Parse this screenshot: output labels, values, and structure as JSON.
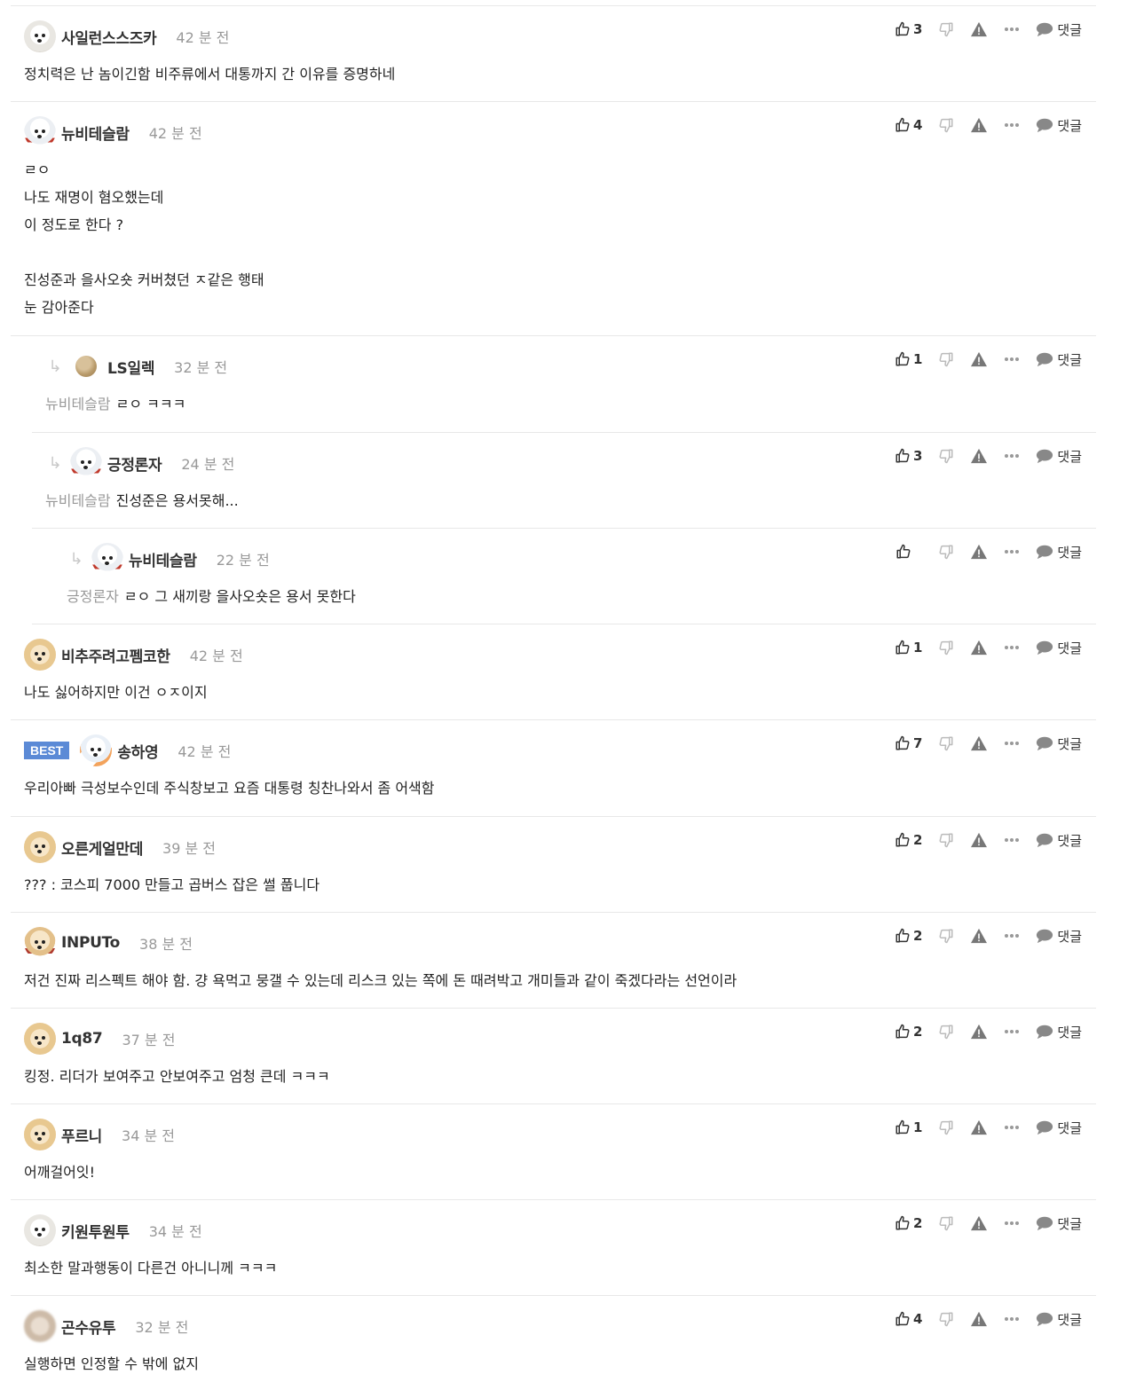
{
  "labels": {
    "reply": "댓글",
    "best": "BEST"
  },
  "comments": [
    {
      "avatar": "samoyed",
      "user": "사일런스스즈카",
      "time": "42 분 전",
      "likes": "3",
      "text": "정치력은 난 놈이긴함 비주류에서 대통까지 간 이유를 증명하네"
    },
    {
      "avatar": "samoyed-scarf",
      "user": "뉴비테슬람",
      "time": "42 분 전",
      "likes": "4",
      "text": "ㄹㅇ\n나도 재명이 혐오했는데\n이 정도로 한다 ?\n\n진성준과 을사오숏 커버쳤던 ㅈ같은 행태\n눈 감아준다"
    },
    {
      "avatar": "ball",
      "user": "LS일렉",
      "time": "32 분 전",
      "likes": "1",
      "mention": "뉴비테슬람",
      "text": "ㄹㅇ ㅋㅋㅋ"
    },
    {
      "avatar": "samoyed-scarf",
      "user": "긍정론자",
      "time": "24 분 전",
      "likes": "3",
      "mention": "뉴비테슬람",
      "text": "진성준은 용서못해..."
    },
    {
      "avatar": "samoyed-scarf",
      "user": "뉴비테슬람",
      "time": "22 분 전",
      "likes": "",
      "mention": "긍정론자",
      "text": "ㄹㅇ 그 새끼랑 을사오숏은 용서 못한다"
    },
    {
      "avatar": "puppy",
      "user": "비추주려고펨코한",
      "time": "42 분 전",
      "likes": "1",
      "text": "나도 싫어하지만 이건 ㅇㅈ이지"
    },
    {
      "avatar": "best",
      "user": "송하영",
      "time": "42 분 전",
      "likes": "7",
      "best": true,
      "text": "우리아빠 극성보수인데 주식창보고 요즘 대통령 칭찬나와서 좀 어색함"
    },
    {
      "avatar": "puppy",
      "user": "오른게얼만데",
      "time": "39 분 전",
      "likes": "2",
      "text": "??? : 코스피 7000 만들고 곱버스 잡은 썰 풉니다"
    },
    {
      "avatar": "puppy-scarf",
      "user": "INPUTo",
      "time": "38 분 전",
      "likes": "2",
      "text": "저건 진짜 리스펙트 해야 함. 걍 욕먹고 뭉갤 수 있는데 리스크 있는 쪽에 돈 때려박고 개미들과 같이 죽겠다라는 선언이라"
    },
    {
      "avatar": "puppy",
      "user": "1q87",
      "time": "37 분 전",
      "likes": "2",
      "text": "킹정. 리더가 보여주고 안보여주고 엄청 큰데 ㅋㅋㅋ"
    },
    {
      "avatar": "puppy",
      "user": "푸르니",
      "time": "34 분 전",
      "likes": "1",
      "text": "어깨걸어잇!"
    },
    {
      "avatar": "samoyed",
      "user": "키원투원투",
      "time": "34 분 전",
      "likes": "2",
      "text": "최소한 말과행동이 다른건 아니니께 ㅋㅋㅋ"
    },
    {
      "avatar": "bear",
      "user": "곤수유투",
      "time": "32 분 전",
      "likes": "4",
      "text": "실행하면 인정할 수 밖에 없지"
    }
  ]
}
